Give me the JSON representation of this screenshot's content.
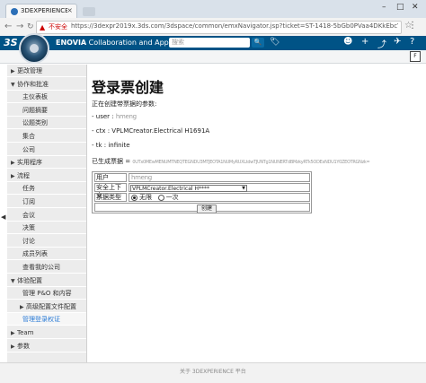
{
  "browser": {
    "tab_title": "3DEXPERIENCE Platfor",
    "tab_close": "×",
    "insecure_label": "不安全",
    "url": "https://3dexpr2019x.3ds.com/3dspace/common/emxNavigator.jsp?ticket=ST-1418-5bGb0PVaa4DKkEbcYx0C-cas..."
  },
  "header": {
    "brand_prefix": "ENOVIA",
    "brand_text": "Collaboration and Approvals",
    "search_placeholder": "搜索"
  },
  "sidebar": {
    "items": [
      {
        "label": "更改管理",
        "arrow": "▶"
      },
      {
        "label": "协作和批准",
        "arrow": "▼"
      },
      {
        "label": "主仪表板",
        "arrow": ""
      },
      {
        "label": "问题摘要",
        "arrow": ""
      },
      {
        "label": "讼题类别",
        "arrow": ""
      },
      {
        "label": "集合",
        "arrow": ""
      },
      {
        "label": "公司",
        "arrow": ""
      },
      {
        "label": "实用程序",
        "arrow": "▶"
      },
      {
        "label": "流程",
        "arrow": "▶"
      },
      {
        "label": "任务",
        "arrow": ""
      },
      {
        "label": "订阅",
        "arrow": ""
      },
      {
        "label": "会议",
        "arrow": ""
      },
      {
        "label": "决策",
        "arrow": ""
      },
      {
        "label": "讨论",
        "arrow": ""
      },
      {
        "label": "成员列表",
        "arrow": ""
      },
      {
        "label": "查看我的公司",
        "arrow": ""
      },
      {
        "label": "体验配置",
        "arrow": "▼"
      },
      {
        "label": "管理 P&O 和内容",
        "arrow": ""
      },
      {
        "label": "高级配置文件配置",
        "arrow": "▶"
      },
      {
        "label": "管理登录权证",
        "arrow": ""
      },
      {
        "label": "Team",
        "arrow": "▶"
      },
      {
        "label": "参数",
        "arrow": "▶"
      }
    ]
  },
  "content": {
    "title": "登录票创建",
    "creating": "正在创建带票据的参数:",
    "user_line": "- user :",
    "user_value": "hmeng",
    "ctx_line": "- ctx : VPLMCreator.Electrical H1691A",
    "tk_line": "- tk : infinite",
    "generated_label": "已生成票据 =",
    "generated_value": "0UTx0MEwMENUMTNEQTEGNDU3MTJEOTA1NUMyRUXLtdwTJUNTg1NUNERTdBMzkyRTk5ODExNDU1Y0ZEOTRGNzk="
  },
  "form": {
    "user_label": "用户",
    "user_value": "hmeng",
    "context_label": "安全上下文",
    "context_value": "VPLMCreator.Electrical H****",
    "ticket_type_label": "票据类型",
    "option_infinite": "无限",
    "option_once": "一次",
    "create_button": "创建"
  },
  "footer": {
    "text": "关于 3DEXPERIENCE 平台"
  }
}
